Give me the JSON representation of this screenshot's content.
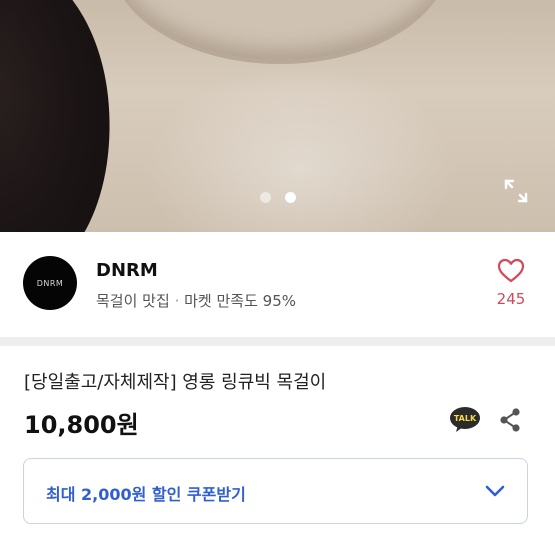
{
  "carousel": {
    "total": 2,
    "active": 2
  },
  "seller": {
    "avatar_text": "DNRM",
    "name": "DNRM",
    "tagline": "목걸이 맛집",
    "separator": "·",
    "satisfaction": "마켓 만족도 95%",
    "likes": "245"
  },
  "product": {
    "title": "[당일출고/자체제작] 영롱 링큐빅 목걸이",
    "price": "10,800원",
    "talk_label": "TALK"
  },
  "coupon": {
    "label": "최대 2,000원 할인 쿠폰받기"
  },
  "colors": {
    "accent": "#2f5fd0",
    "heart": "#d6475a",
    "talk_bg": "#2b2b2b",
    "talk_bubble": "#f7d94c"
  },
  "icons": {
    "expand": "expand-icon",
    "heart": "heart-icon",
    "talk": "kakao-talk-icon",
    "share": "share-icon",
    "chevron": "chevron-down-icon"
  }
}
